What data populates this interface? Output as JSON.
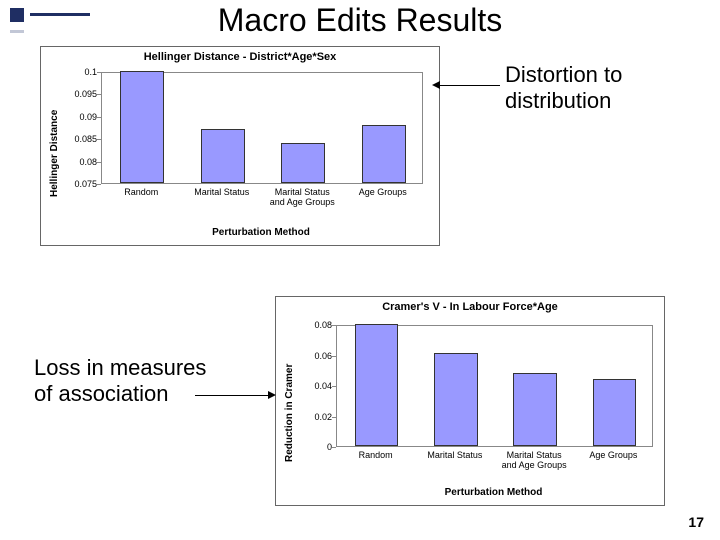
{
  "title": "Macro Edits Results",
  "annot1": "Distortion to\ndistribution",
  "annot2": "Loss in measures\nof association",
  "pagenum": "17",
  "chart_data": [
    {
      "type": "bar",
      "title": "Hellinger Distance - District*Age*Sex",
      "ylabel": "Hellinger Distance",
      "xlabel": "Perturbation Method",
      "categories": [
        "Random",
        "Marital Status",
        "Marital Status\nand Age Groups",
        "Age Groups"
      ],
      "values": [
        0.1,
        0.087,
        0.084,
        0.088
      ],
      "ylim": [
        0.075,
        0.1
      ],
      "yticks": [
        0.075,
        0.08,
        0.085,
        0.09,
        0.095,
        0.1
      ]
    },
    {
      "type": "bar",
      "title": "Cramer's V - In Labour Force*Age",
      "ylabel": "Reduction in Cramer",
      "xlabel": "Perturbation Method",
      "categories": [
        "Random",
        "Marital Status",
        "Marital Status\nand Age Groups",
        "Age Groups"
      ],
      "values": [
        0.08,
        0.061,
        0.048,
        0.044
      ],
      "ylim": [
        0,
        0.08
      ],
      "yticks": [
        0,
        0.02,
        0.04,
        0.06,
        0.08
      ]
    }
  ]
}
